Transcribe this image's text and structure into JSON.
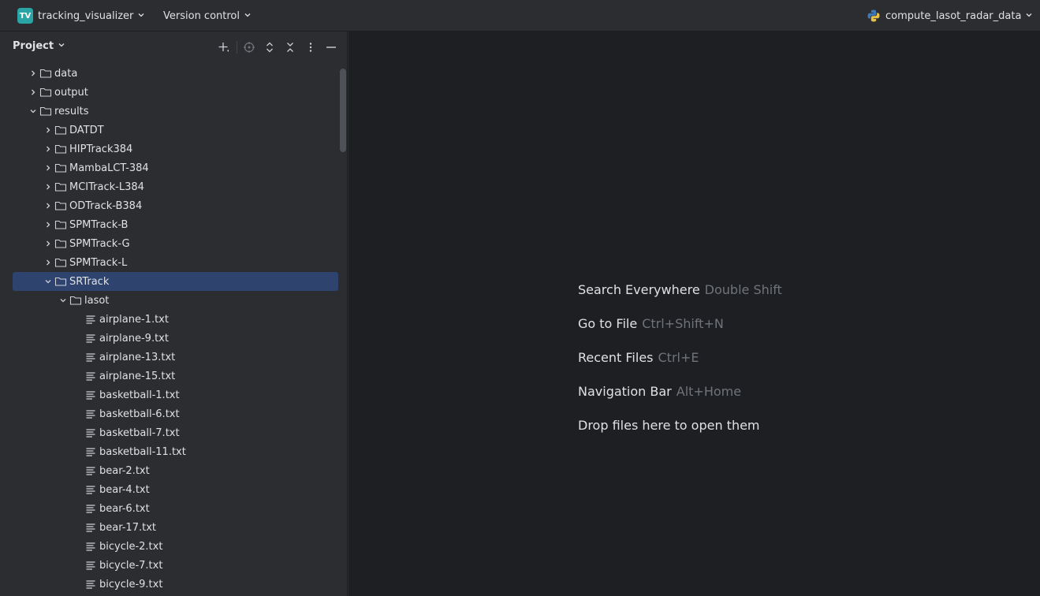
{
  "topbar": {
    "project_badge": "TV",
    "project_name": "tracking_visualizer",
    "version_control": "Version control",
    "run_config": "compute_lasot_radar_data"
  },
  "sidebar": {
    "title": "Project"
  },
  "tree": [
    {
      "label": "data",
      "type": "folder",
      "depth": 1,
      "expanded": false
    },
    {
      "label": "output",
      "type": "folder",
      "depth": 1,
      "expanded": false
    },
    {
      "label": "results",
      "type": "folder",
      "depth": 1,
      "expanded": true
    },
    {
      "label": "DATDT",
      "type": "folder",
      "depth": 2,
      "expanded": false
    },
    {
      "label": "HIPTrack384",
      "type": "folder",
      "depth": 2,
      "expanded": false
    },
    {
      "label": "MambaLCT-384",
      "type": "folder",
      "depth": 2,
      "expanded": false
    },
    {
      "label": "MCITrack-L384",
      "type": "folder",
      "depth": 2,
      "expanded": false
    },
    {
      "label": "ODTrack-B384",
      "type": "folder",
      "depth": 2,
      "expanded": false
    },
    {
      "label": "SPMTrack-B",
      "type": "folder",
      "depth": 2,
      "expanded": false
    },
    {
      "label": "SPMTrack-G",
      "type": "folder",
      "depth": 2,
      "expanded": false
    },
    {
      "label": "SPMTrack-L",
      "type": "folder",
      "depth": 2,
      "expanded": false
    },
    {
      "label": "SRTrack",
      "type": "folder",
      "depth": 2,
      "expanded": true,
      "selected": true
    },
    {
      "label": "lasot",
      "type": "folder",
      "depth": 3,
      "expanded": true
    },
    {
      "label": "airplane-1.txt",
      "type": "file",
      "depth": 4
    },
    {
      "label": "airplane-9.txt",
      "type": "file",
      "depth": 4
    },
    {
      "label": "airplane-13.txt",
      "type": "file",
      "depth": 4
    },
    {
      "label": "airplane-15.txt",
      "type": "file",
      "depth": 4
    },
    {
      "label": "basketball-1.txt",
      "type": "file",
      "depth": 4
    },
    {
      "label": "basketball-6.txt",
      "type": "file",
      "depth": 4
    },
    {
      "label": "basketball-7.txt",
      "type": "file",
      "depth": 4
    },
    {
      "label": "basketball-11.txt",
      "type": "file",
      "depth": 4
    },
    {
      "label": "bear-2.txt",
      "type": "file",
      "depth": 4
    },
    {
      "label": "bear-4.txt",
      "type": "file",
      "depth": 4
    },
    {
      "label": "bear-6.txt",
      "type": "file",
      "depth": 4
    },
    {
      "label": "bear-17.txt",
      "type": "file",
      "depth": 4
    },
    {
      "label": "bicycle-2.txt",
      "type": "file",
      "depth": 4
    },
    {
      "label": "bicycle-7.txt",
      "type": "file",
      "depth": 4
    },
    {
      "label": "bicycle-9.txt",
      "type": "file",
      "depth": 4
    }
  ],
  "editor": {
    "hints": [
      {
        "action": "Search Everywhere",
        "shortcut": "Double Shift"
      },
      {
        "action": "Go to File",
        "shortcut": "Ctrl+Shift+N"
      },
      {
        "action": "Recent Files",
        "shortcut": "Ctrl+E"
      },
      {
        "action": "Navigation Bar",
        "shortcut": "Alt+Home"
      },
      {
        "action": "Drop files here to open them",
        "shortcut": ""
      }
    ]
  },
  "colors": {
    "panel_bg": "#2b2d30",
    "editor_bg": "#1e1f22",
    "selection": "#2e436e",
    "text": "#dfe1e5",
    "muted": "#6f737a"
  }
}
